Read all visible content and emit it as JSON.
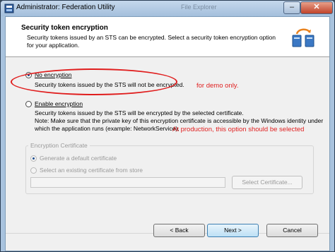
{
  "window": {
    "title": "Administrator: Federation Utility",
    "background_title": "File Explorer"
  },
  "header": {
    "title": "Security token encryption",
    "description": "Security tokens issued by an STS can be encrypted. Select a security token encryption option for your application."
  },
  "options": {
    "no_encryption": {
      "label": "No encryption",
      "description": "Security tokens issued by the STS will not be encrypted.",
      "selected": true
    },
    "enable_encryption": {
      "label": "Enable encryption",
      "description_line1": "Security tokens issued by the STS will be encrypted by the selected certificate.",
      "description_line2": "Note: Make sure that the private key of this encryption certificate is accessible by the Windows identity under",
      "description_line3": "which the application runs (example: NetworkService).",
      "selected": false
    }
  },
  "annotations": {
    "demo": "for demo only.",
    "production": "At production, this option should be selected",
    "color": "#e02020"
  },
  "certificate_group": {
    "title": "Encryption Certificate",
    "generate_default": "Generate a default certificate",
    "select_existing": "Select an existing certificate from store",
    "certificate_value": "",
    "select_button": "Select Certificate..."
  },
  "buttons": {
    "back": "< Back",
    "next": "Next >",
    "cancel": "Cancel"
  }
}
